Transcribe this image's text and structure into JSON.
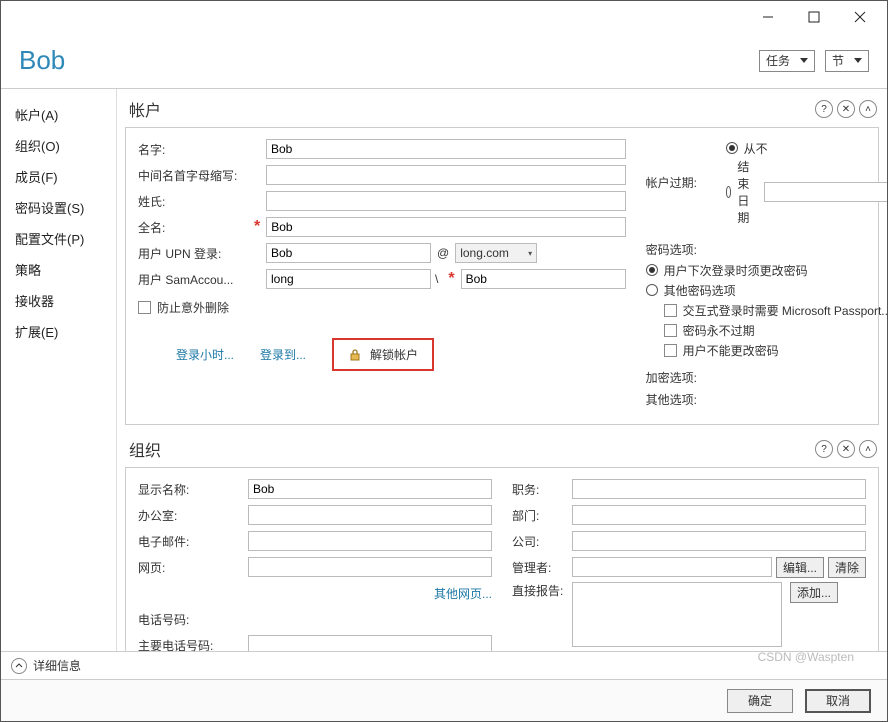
{
  "header": {
    "title": "Bob",
    "tasks_btn": "任务",
    "section_btn": "节"
  },
  "sidebar": {
    "items": [
      {
        "label": "帐户(A)"
      },
      {
        "label": "组织(O)"
      },
      {
        "label": "成员(F)"
      },
      {
        "label": "密码设置(S)"
      },
      {
        "label": "配置文件(P)"
      },
      {
        "label": "策略"
      },
      {
        "label": "接收器"
      },
      {
        "label": "扩展(E)"
      }
    ]
  },
  "account_section": {
    "title": "帐户",
    "left": {
      "first_name_label": "名字:",
      "first_name": "Bob",
      "initials_label": "中间名首字母缩写:",
      "initials": "",
      "last_name_label": "姓氏:",
      "last_name": "",
      "full_name_label": "全名:",
      "full_name": "Bob",
      "upn_label": "用户 UPN 登录:",
      "upn_user": "Bob",
      "upn_domain": "long.com",
      "sam_label": "用户 SamAccou...",
      "sam_domain": "long",
      "sam_user": "Bob",
      "protect_delete": "防止意外删除"
    },
    "right": {
      "expire_label": "帐户过期:",
      "never": "从不",
      "end_date": "结束日期",
      "pwd_options_label": "密码选项:",
      "pwd_change_next": "用户下次登录时须更改密码",
      "pwd_other": "其他密码选项",
      "passport": "交互式登录时需要 Microsoft Passport...",
      "never_expire": "密码永不过期",
      "cannot_change": "用户不能更改密码",
      "encrypt_label": "加密选项:",
      "other_label": "其他选项:"
    },
    "links": {
      "logon_hours": "登录小时...",
      "logon_to": "登录到...",
      "unlock": "解锁帐户"
    }
  },
  "org_section": {
    "title": "组织",
    "left": {
      "display_name_label": "显示名称:",
      "display_name": "Bob",
      "office_label": "办公室:",
      "office": "",
      "email_label": "电子邮件:",
      "email": "",
      "web_label": "网页:",
      "web": "",
      "other_web": "其他网页...",
      "phone_label": "电话号码:",
      "main_phone_label": "主要电话号码:"
    },
    "right": {
      "title_label": "职务:",
      "title": "",
      "dept_label": "部门:",
      "dept": "",
      "company_label": "公司:",
      "company": "",
      "manager_label": "管理者:",
      "edit_btn": "编辑...",
      "clear_btn": "清除",
      "direct_reports_label": "直接报告:",
      "add_btn": "添加..."
    }
  },
  "footer": {
    "details": "详细信息",
    "ok": "确定",
    "cancel": "取消"
  },
  "watermark": "CSDN @Waspten"
}
